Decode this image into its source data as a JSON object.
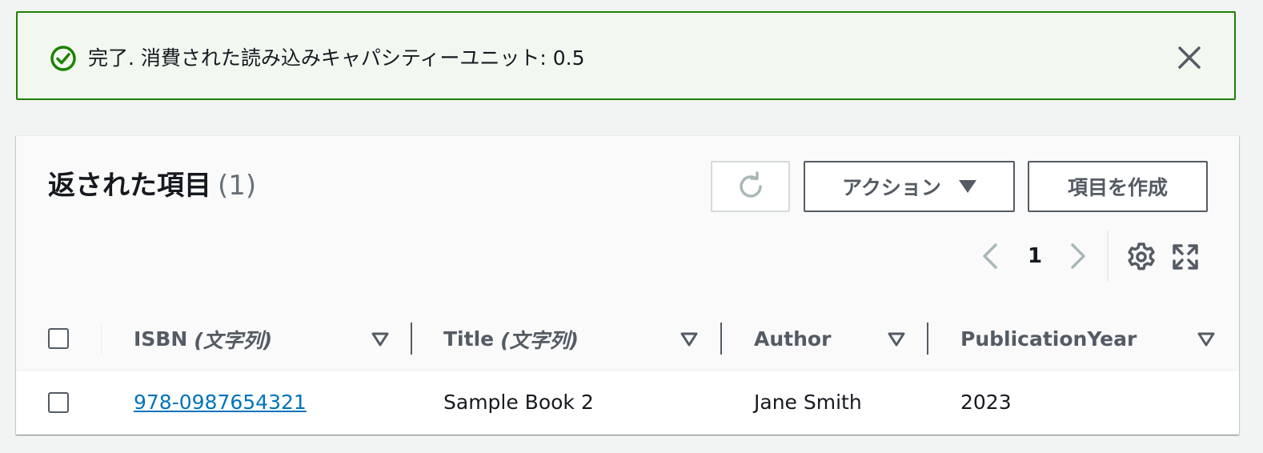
{
  "flash": {
    "type": "success",
    "message": "完了. 消費された読み込みキャパシティーユニット: 0.5",
    "icon": "check-circle-icon",
    "color": "#1d8102"
  },
  "table": {
    "title": "返された項目",
    "count": "(1)",
    "actions_label": "アクション",
    "create_label": "項目を作成",
    "pagination": {
      "current_page": "1"
    },
    "columns": [
      {
        "name": "ISBN",
        "type": "(文字列)"
      },
      {
        "name": "Title",
        "type": "(文字列)"
      },
      {
        "name": "Author",
        "type": ""
      },
      {
        "name": "PublicationYear",
        "type": ""
      }
    ],
    "rows": [
      {
        "isbn": "978-0987654321",
        "title": "Sample Book 2",
        "author": "Jane Smith",
        "publication_year": "2023"
      }
    ]
  },
  "colors": {
    "link": "#0073bb",
    "border": "#545b64",
    "success": "#1d8102"
  }
}
